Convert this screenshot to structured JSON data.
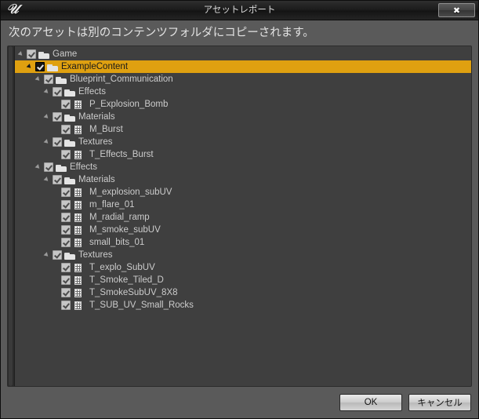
{
  "window": {
    "logo_icon": "unreal-engine-logo",
    "title": "アセットレポート",
    "close_label": "✖"
  },
  "content": {
    "headline": "次のアセットは別のコンテンツフォルダにコピーされます。"
  },
  "tree": {
    "items": [
      {
        "label": "Game",
        "depth": 0,
        "type": "folder",
        "expander": true,
        "checked": true,
        "selected": false
      },
      {
        "label": "ExampleContent",
        "depth": 1,
        "type": "folder",
        "expander": true,
        "checked": true,
        "selected": true
      },
      {
        "label": "Blueprint_Communication",
        "depth": 2,
        "type": "folder",
        "expander": true,
        "checked": true,
        "selected": false
      },
      {
        "label": "Effects",
        "depth": 3,
        "type": "folder",
        "expander": true,
        "checked": true,
        "selected": false
      },
      {
        "label": "P_Explosion_Bomb",
        "depth": 4,
        "type": "file",
        "expander": false,
        "checked": true,
        "selected": false
      },
      {
        "label": "Materials",
        "depth": 3,
        "type": "folder",
        "expander": true,
        "checked": true,
        "selected": false
      },
      {
        "label": "M_Burst",
        "depth": 4,
        "type": "file",
        "expander": false,
        "checked": true,
        "selected": false
      },
      {
        "label": "Textures",
        "depth": 3,
        "type": "folder",
        "expander": true,
        "checked": true,
        "selected": false
      },
      {
        "label": "T_Effects_Burst",
        "depth": 4,
        "type": "file",
        "expander": false,
        "checked": true,
        "selected": false
      },
      {
        "label": "Effects",
        "depth": 2,
        "type": "folder",
        "expander": true,
        "checked": true,
        "selected": false
      },
      {
        "label": "Materials",
        "depth": 3,
        "type": "folder",
        "expander": true,
        "checked": true,
        "selected": false
      },
      {
        "label": "M_explosion_subUV",
        "depth": 4,
        "type": "file",
        "expander": false,
        "checked": true,
        "selected": false
      },
      {
        "label": "m_flare_01",
        "depth": 4,
        "type": "file",
        "expander": false,
        "checked": true,
        "selected": false
      },
      {
        "label": "M_radial_ramp",
        "depth": 4,
        "type": "file",
        "expander": false,
        "checked": true,
        "selected": false
      },
      {
        "label": "M_smoke_subUV",
        "depth": 4,
        "type": "file",
        "expander": false,
        "checked": true,
        "selected": false
      },
      {
        "label": "small_bits_01",
        "depth": 4,
        "type": "file",
        "expander": false,
        "checked": true,
        "selected": false
      },
      {
        "label": "Textures",
        "depth": 3,
        "type": "folder",
        "expander": true,
        "checked": true,
        "selected": false
      },
      {
        "label": "T_explo_SubUV",
        "depth": 4,
        "type": "file",
        "expander": false,
        "checked": true,
        "selected": false
      },
      {
        "label": "T_Smoke_Tiled_D",
        "depth": 4,
        "type": "file",
        "expander": false,
        "checked": true,
        "selected": false
      },
      {
        "label": "T_SmokeSubUV_8X8",
        "depth": 4,
        "type": "file",
        "expander": false,
        "checked": true,
        "selected": false
      },
      {
        "label": "T_SUB_UV_Small_Rocks",
        "depth": 4,
        "type": "file",
        "expander": false,
        "checked": true,
        "selected": false
      }
    ]
  },
  "footer": {
    "ok_label": "OK",
    "cancel_label": "キャンセル"
  },
  "colors": {
    "selection": "#dfa010",
    "panel_bg": "#3f3f3f",
    "dialog_bg": "#5a5a5a",
    "text": "#cccccc"
  }
}
